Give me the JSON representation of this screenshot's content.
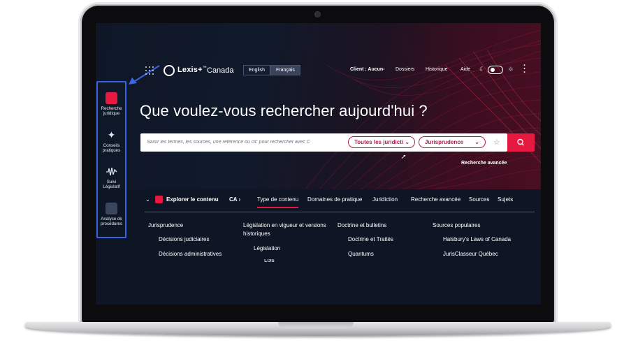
{
  "sidebar": {
    "items": [
      {
        "label": "Recherche juridique",
        "icon": "legal-research-icon",
        "color": "#e61941"
      },
      {
        "label": "Conseils pratiques",
        "icon": "compass-icon",
        "color": "#2b3a57"
      },
      {
        "label": "Suivi Législatif",
        "icon": "waveform-icon",
        "color": "#2b3a57"
      },
      {
        "label": "Analyse de procédures",
        "icon": "chart-icon",
        "color": "#2b3a57"
      }
    ]
  },
  "header": {
    "brand": "Lexis+",
    "brand_tm": "™",
    "brand_region": "Canada",
    "lang_en": "English",
    "lang_fr": "Français",
    "client": "Client : Aucun-",
    "dossiers": "Dossiers",
    "historique": "Historique",
    "aide": "Aide"
  },
  "hero": {
    "headline": "Que voulez-vous rechercher aujourd'hui ?"
  },
  "search": {
    "placeholder": "Saisir les termes, les sources, une référence ou cit: pour rechercher avec C",
    "jurisdiction": "Toutes les juridicti",
    "content_type": "Jurisprudence",
    "advanced": "Recherche avancée"
  },
  "explore": {
    "label": "Explorer le contenu",
    "region": "CA",
    "tabs": [
      "Type de contenu",
      "Domaines de pratique",
      "Juridiction",
      "Recherche avancée",
      "Sources",
      "Sujets"
    ]
  },
  "columns": [
    {
      "heading": "Jurisprudence",
      "items": [
        "Décisions judiciaires",
        "Décisions administratives"
      ]
    },
    {
      "heading": "Législation en vigueur et versions historiques",
      "items": [
        "Législation",
        "Lois"
      ]
    },
    {
      "heading": "Doctrine et bulletins",
      "items": [
        "Doctrine et Traités",
        "Quantums"
      ]
    },
    {
      "heading": "Sources populaires",
      "items": [
        "Halsbury's Laws of Canada",
        "JurisClasseur Québec"
      ]
    }
  ],
  "colors": {
    "accent": "#e61941",
    "navy": "#0e1626",
    "highlight_frame": "#3a64e6"
  }
}
